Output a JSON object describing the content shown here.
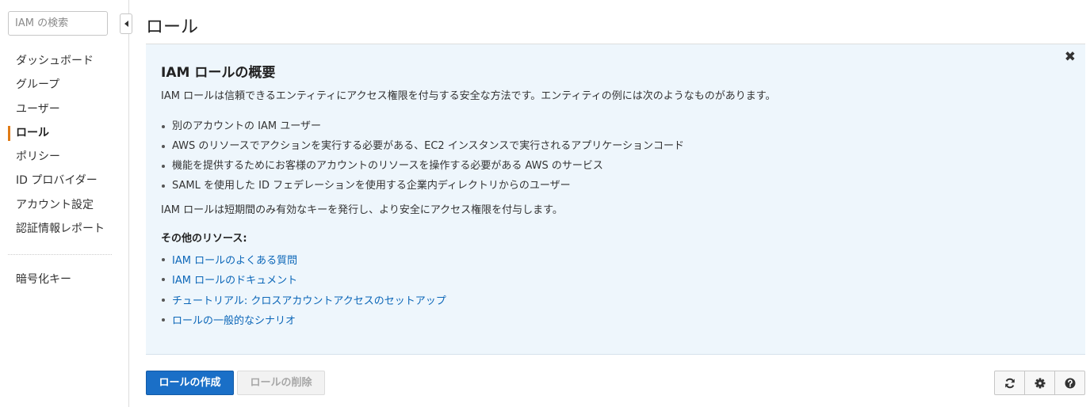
{
  "sidebar": {
    "search_placeholder": "IAM の検索",
    "items": [
      {
        "label": "ダッシュボード"
      },
      {
        "label": "グループ"
      },
      {
        "label": "ユーザー"
      },
      {
        "label": "ロール",
        "active": true
      },
      {
        "label": "ポリシー"
      },
      {
        "label": "ID プロバイダー"
      },
      {
        "label": "アカウント設定"
      },
      {
        "label": "認証情報レポート"
      }
    ],
    "extra_items": [
      {
        "label": "暗号化キー"
      }
    ],
    "active_accent_color": "#e07b17"
  },
  "page": {
    "title": "ロール"
  },
  "info_panel": {
    "background_color": "#eef6fc",
    "close_icon": "close-icon",
    "title": "IAM ロールの概要",
    "intro": "IAM ロールは信頼できるエンティティにアクセス権限を付与する安全な方法です。エンティティの例には次のようなものがあります。",
    "bullets": [
      "別のアカウントの IAM ユーザー",
      "AWS のリソースでアクションを実行する必要がある、EC2 インスタンスで実行されるアプリケーションコード",
      "機能を提供するためにお客様のアカウントのリソースを操作する必要がある AWS のサービス",
      "SAML を使用した ID フェデレーションを使用する企業内ディレクトリからのユーザー"
    ],
    "summary": "IAM ロールは短期間のみ有効なキーを発行し、より安全にアクセス権限を付与します。",
    "resources_heading": "その他のリソース:",
    "links": [
      "IAM ロールのよくある質問",
      "IAM ロールのドキュメント",
      "チュートリアル: クロスアカウントアクセスのセットアップ",
      "ロールの一般的なシナリオ"
    ],
    "link_color": "#0b66b8"
  },
  "actions": {
    "create_label": "ロールの作成",
    "delete_label": "ロールの削除",
    "primary_color": "#1a6fc7"
  },
  "toolbar": {
    "icons": [
      "refresh-icon",
      "gear-icon",
      "help-icon"
    ]
  }
}
